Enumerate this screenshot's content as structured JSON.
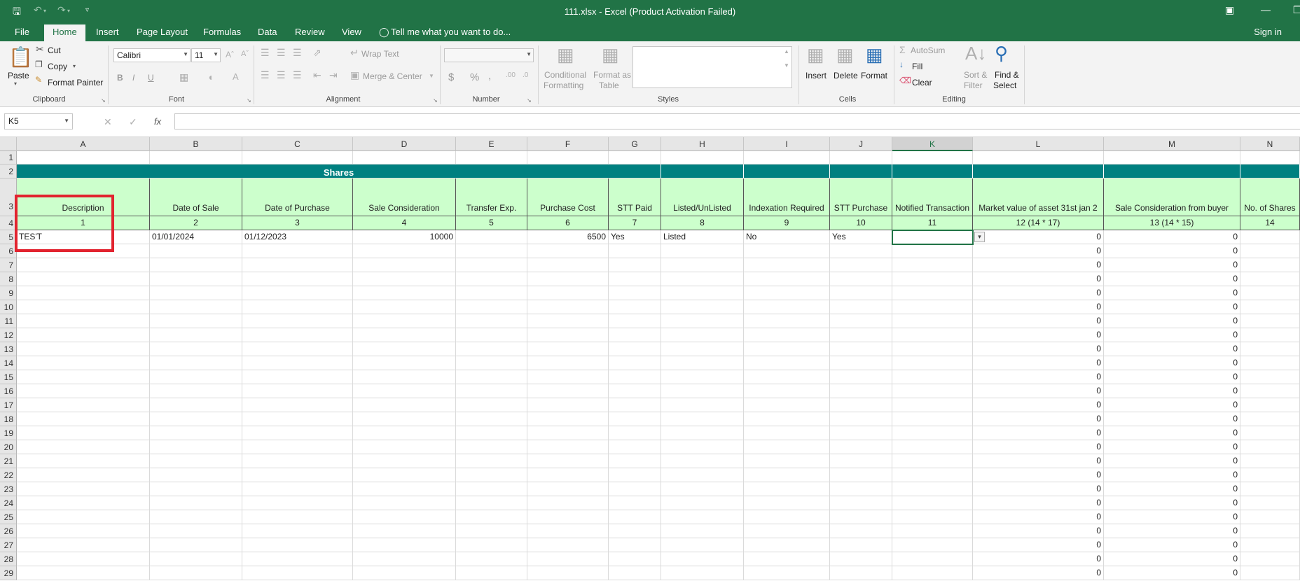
{
  "title_bar": {
    "window_title": "111.xlsx - Excel (Product Activation Failed)"
  },
  "tabs": [
    "File",
    "Home",
    "Insert",
    "Page Layout",
    "Formulas",
    "Data",
    "Review",
    "View"
  ],
  "tell_me": "Tell me what you want to do...",
  "sign_in": "Sign in",
  "ribbon": {
    "clipboard": {
      "paste": "Paste",
      "cut": "Cut",
      "copy": "Copy",
      "format_painter": "Format Painter",
      "label": "Clipboard"
    },
    "font": {
      "name": "Calibri",
      "size": "11",
      "bold": "B",
      "italic": "I",
      "underline": "U",
      "label": "Font"
    },
    "alignment": {
      "wrap_text": "Wrap Text",
      "merge_center": "Merge & Center",
      "label": "Alignment"
    },
    "number": {
      "currency": "$",
      "percent": "%",
      "comma": ",",
      "label": "Number"
    },
    "styles": {
      "conditional": "Conditional",
      "conditional2": "Formatting",
      "format_as": "Format as",
      "format_as2": "Table",
      "label": "Styles"
    },
    "cells": {
      "insert": "Insert",
      "delete": "Delete",
      "format": "Format",
      "label": "Cells"
    },
    "editing": {
      "autosum": "AutoSum",
      "fill": "Fill",
      "clear": "Clear",
      "sort": "Sort &",
      "sort2": "Filter",
      "find": "Find &",
      "find2": "Select",
      "label": "Editing"
    }
  },
  "name_box": "K5",
  "fx": "fx",
  "columns": [
    "A",
    "B",
    "C",
    "D",
    "E",
    "F",
    "G",
    "H",
    "I",
    "J",
    "K",
    "L",
    "M",
    "N"
  ],
  "selected_column": "K",
  "rows": [
    "1",
    "2",
    "3",
    "4",
    "5",
    "6",
    "7",
    "8",
    "9",
    "10",
    "11",
    "12",
    "13",
    "14",
    "15",
    "16",
    "17",
    "18",
    "19",
    "20",
    "21",
    "22",
    "23",
    "24",
    "25",
    "26",
    "27",
    "28",
    "29"
  ],
  "sheet": {
    "section_title": "Shares",
    "headers": [
      "Description",
      "Date of Sale",
      "Date of Purchase",
      "Sale Consideration",
      "Transfer Exp.",
      "Purchase Cost",
      "STT Paid",
      "Listed/UnListed",
      "Indexation Required",
      "STT Purchase",
      "Notified Transaction",
      "Market value of asset 31st jan 2",
      "Sale Consideration from buyer",
      "No. of Shares"
    ],
    "numbers": [
      "1",
      "2",
      "3",
      "4",
      "5",
      "6",
      "7",
      "8",
      "9",
      "10",
      "11",
      "12 (14 * 17)",
      "13 (14 * 15)",
      "14"
    ],
    "row5": [
      "TES'T",
      "01/01/2024",
      "01/12/2023",
      "10000",
      "",
      "6500",
      "Yes",
      "Listed",
      "No",
      "Yes",
      "",
      "0",
      "0",
      ""
    ],
    "zero": "0"
  }
}
